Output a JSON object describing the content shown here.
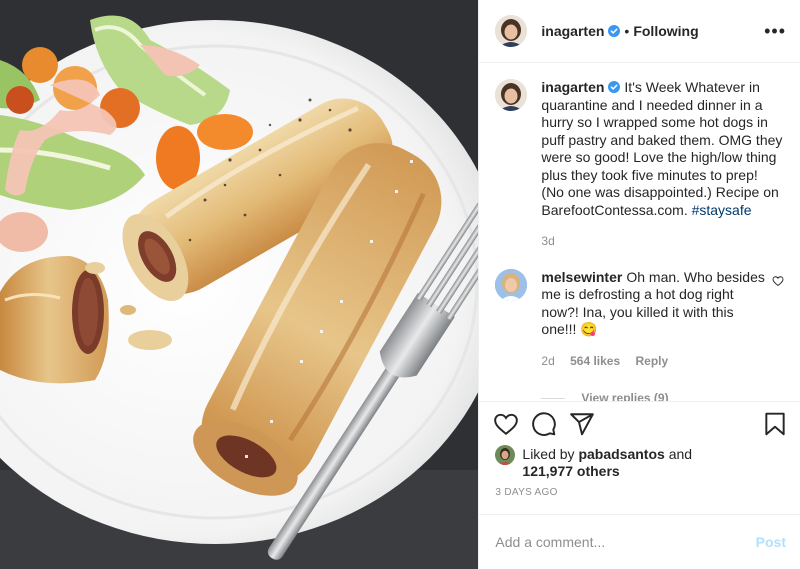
{
  "post": {
    "image_alt": "Puff pastry wrapped hot dogs on a white plate with a salad and a fork",
    "author": {
      "username": "inagarten",
      "verified": true,
      "follow_state": "Following"
    },
    "caption": {
      "username": "inagarten",
      "text": "It's Week Whatever in quarantine and I needed dinner in a hurry so I wrapped some hot dogs in puff pastry and baked them. OMG they were so good! Love the high/low thing plus they took five minutes to prep! (No one was disappointed.) Recipe on BarefootContessa.com.",
      "hashtag": "#staysafe",
      "age": "3d"
    },
    "comments": [
      {
        "username": "melsewinter",
        "text": "Oh man. Who besides me is defrosting a hot dog right now?! Ina, you killed it with this one!!! 😋",
        "age": "2d",
        "likes": "564 likes",
        "reply_label": "Reply",
        "view_replies": "View replies (9)"
      }
    ],
    "liked_by": {
      "prefix": "Liked by",
      "user": "pabadsantos",
      "conjunction": "and",
      "others": "121,977 others"
    },
    "timestamp": "3 DAYS AGO",
    "add_comment": {
      "placeholder": "Add a comment...",
      "post_label": "Post"
    },
    "icons": {
      "more": "more-options-icon",
      "like": "heart-icon",
      "comment": "comment-icon",
      "share": "share-icon",
      "save": "bookmark-icon",
      "verified": "verified-badge-icon"
    },
    "colors": {
      "verified": "#3897f0",
      "hashtag": "#00376b",
      "muted": "#8e8e8e",
      "post_button": "#b2dffc"
    }
  }
}
